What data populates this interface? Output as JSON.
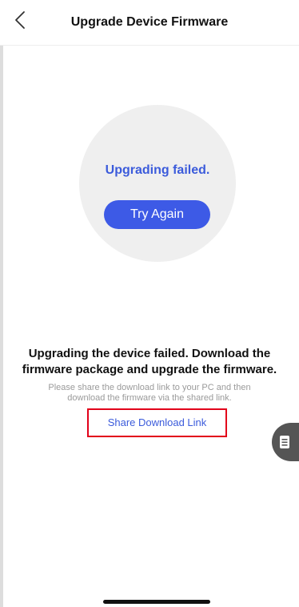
{
  "header": {
    "title": "Upgrade Device Firmware",
    "back_icon": "chevron-left-icon"
  },
  "status": {
    "text": "Upgrading failed.",
    "try_again_label": "Try Again"
  },
  "message": {
    "main": "Upgrading the device failed. Download the firmware package and upgrade the firmware.",
    "hint": "Please share the download link to your PC and then download the firmware via the shared link.",
    "share_link_label": "Share Download Link"
  },
  "floating_button": {
    "icon": "document-icon"
  },
  "colors": {
    "accent": "#3d5ae6",
    "status_text": "#3b5bdb",
    "highlight_border": "#e2001a"
  }
}
